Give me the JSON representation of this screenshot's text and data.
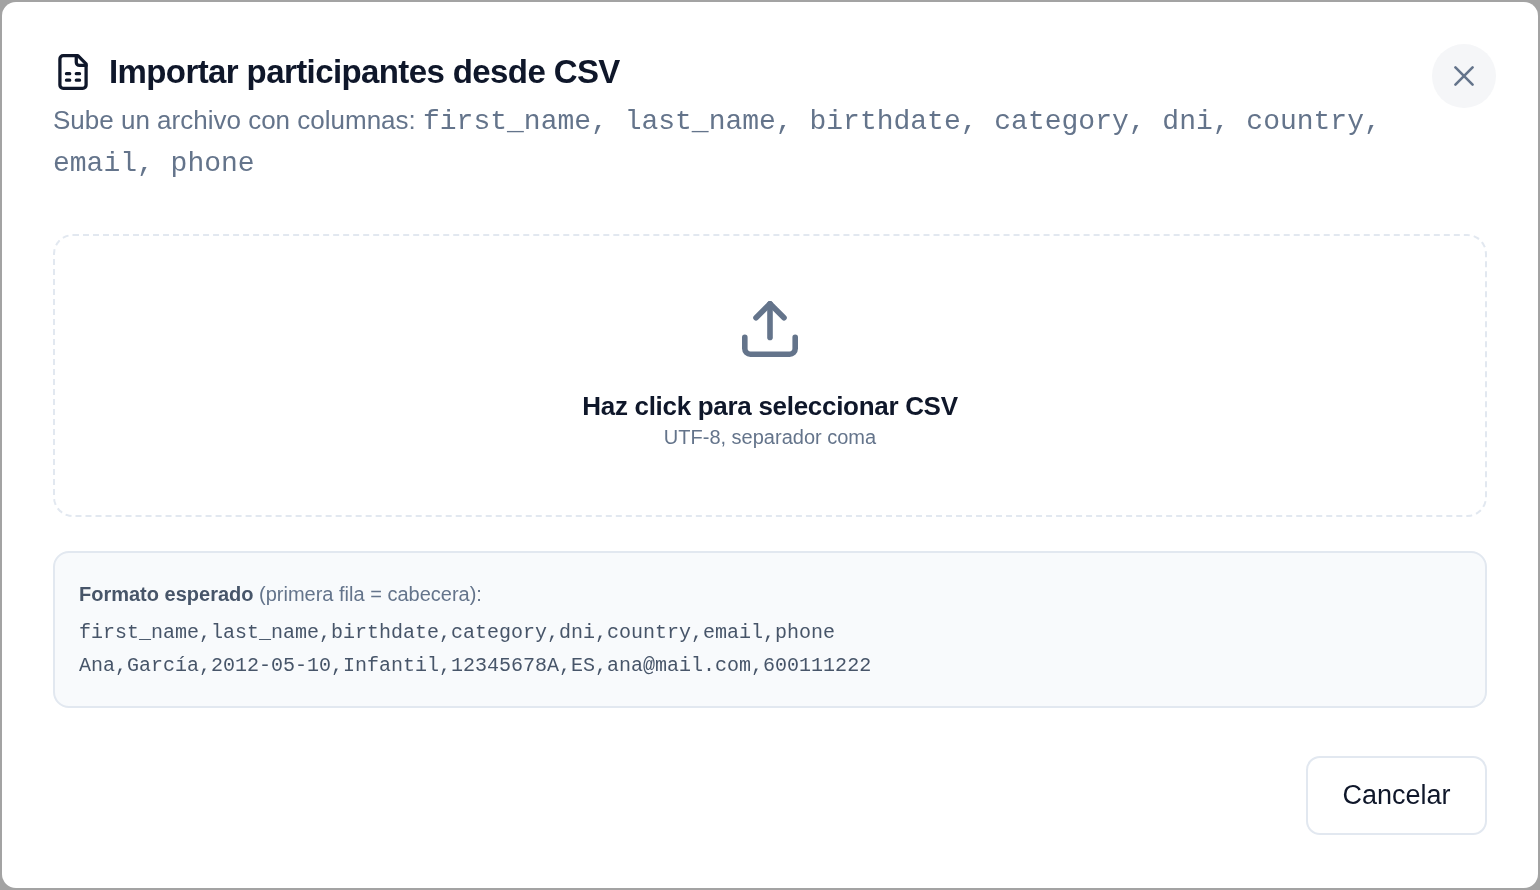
{
  "dialog": {
    "title": "Importar participantes desde CSV",
    "description": {
      "intro": "Sube un archivo con columnas:",
      "columns": "first_name, last_name, birthdate, category, dni, country, email, phone"
    }
  },
  "dropzone": {
    "label": "Haz click para seleccionar CSV",
    "hint": "UTF-8, separador coma"
  },
  "format_example": {
    "heading": "**Formato esperado** (primera fila = cabecera):",
    "lines": [
      "first_name,last_name,birthdate,category,dni,country,email,phone",
      "Ana,García,2012-05-10,Infantil,12345678A,ES,ana@mail.com,600111222"
    ]
  },
  "buttons": [
    "Cancelar"
  ]
}
